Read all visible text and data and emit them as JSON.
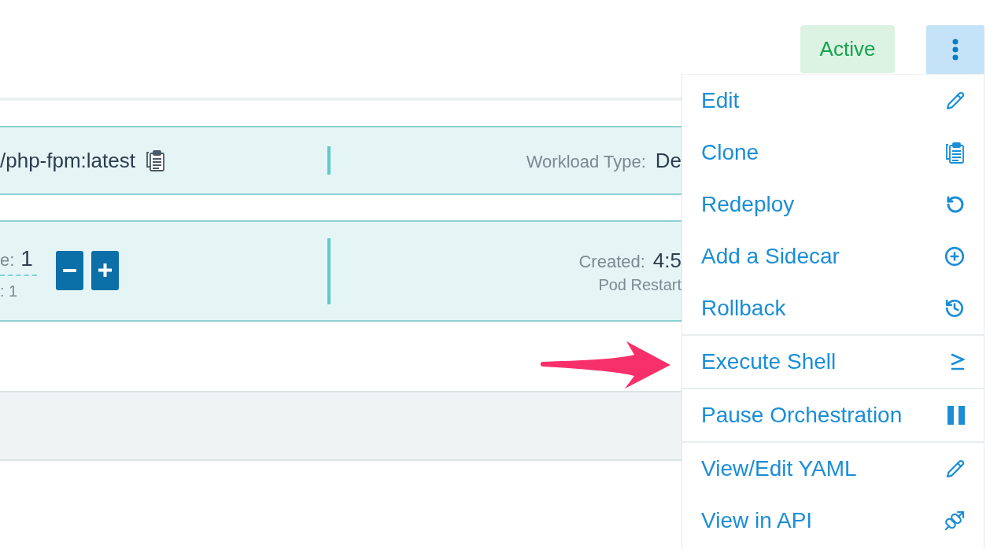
{
  "header": {
    "status_badge": "Active"
  },
  "image_row": {
    "image": "/php-fpm:latest",
    "workload_type": {
      "label": "Workload Type:",
      "value": "De"
    }
  },
  "scale_row": {
    "scale": {
      "label": "e:",
      "value": "1"
    },
    "scale_line_2": ": 1",
    "created": {
      "label": "Created:",
      "value": "4:5"
    },
    "pod_restarts": "Pod Restart"
  },
  "actions_menu": {
    "expanded": true,
    "groups": [
      {
        "items": [
          {
            "label": "Edit",
            "kind": "edit"
          },
          {
            "label": "Clone",
            "kind": "clone"
          },
          {
            "label": "Redeploy",
            "kind": "redeploy"
          },
          {
            "label": "Add a Sidecar",
            "kind": "sidecar"
          },
          {
            "label": "Rollback",
            "kind": "rollback"
          }
        ]
      },
      {
        "items": [
          {
            "label": "Execute Shell",
            "kind": "shell"
          }
        ]
      },
      {
        "items": [
          {
            "label": "Pause Orchestration",
            "kind": "pause"
          }
        ]
      },
      {
        "items": [
          {
            "label": "View/Edit YAML",
            "kind": "yaml"
          },
          {
            "label": "View in API",
            "kind": "api"
          }
        ]
      }
    ]
  }
}
